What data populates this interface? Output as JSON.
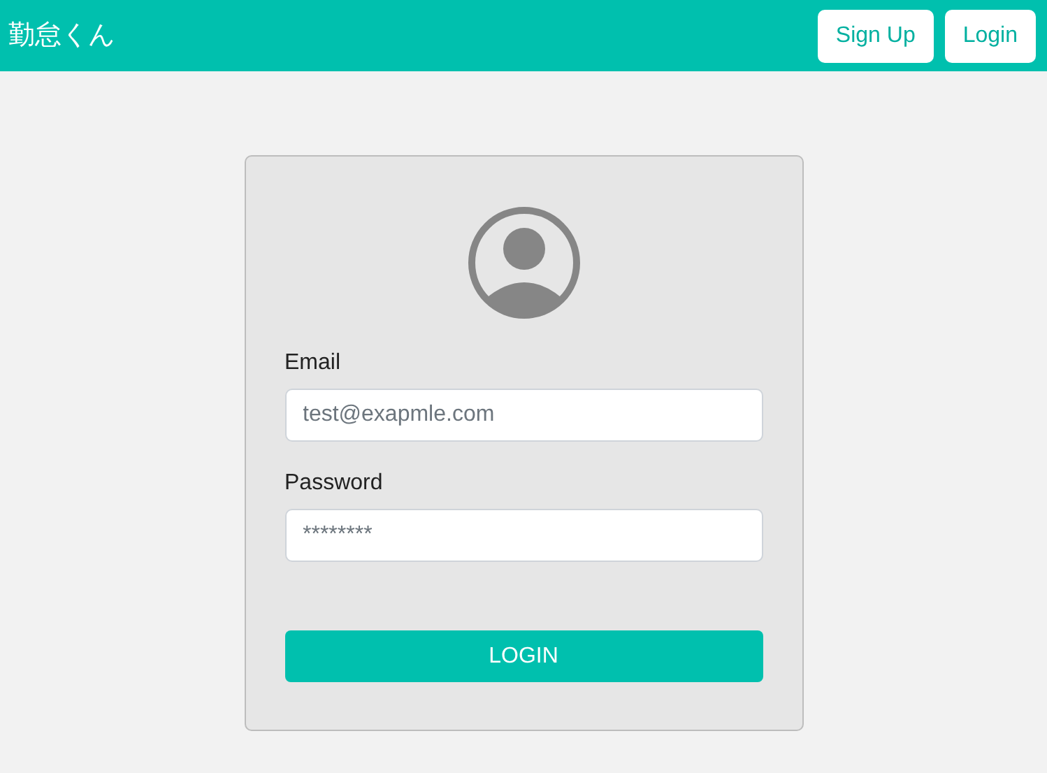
{
  "navbar": {
    "brand": "勤怠くん",
    "buttons": [
      "Sign Up",
      "Login"
    ]
  },
  "login_form": {
    "fields": [
      {
        "label": "Email",
        "placeholder": "test@exapmle.com"
      },
      {
        "label": "Password",
        "placeholder": "********"
      }
    ],
    "submit": "LOGIN"
  }
}
